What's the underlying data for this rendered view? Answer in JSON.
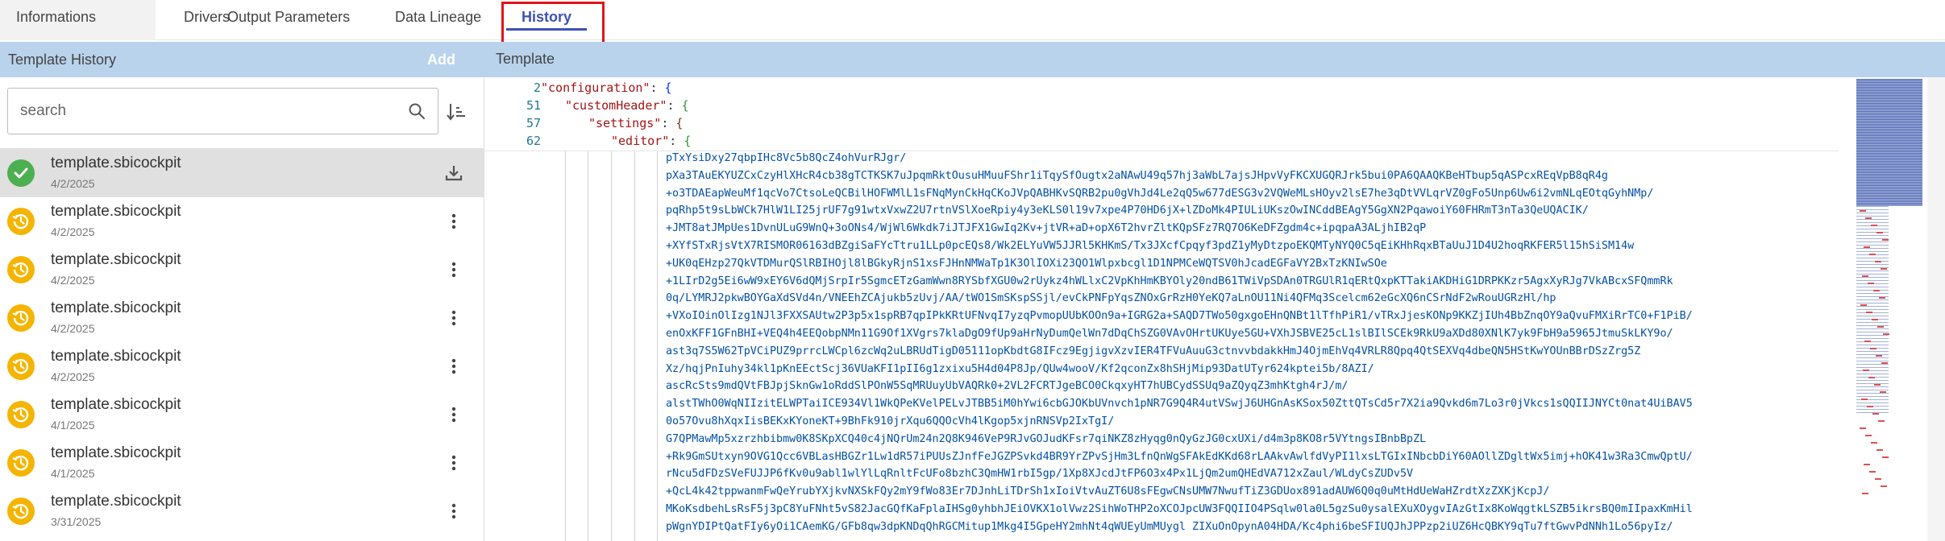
{
  "tabs": [
    {
      "label": "Informations"
    },
    {
      "label": "Drivers"
    },
    {
      "label": "Output Parameters"
    },
    {
      "label": "Data Lineage"
    },
    {
      "label": "History",
      "active": true
    }
  ],
  "header": {
    "left_title": "Template History",
    "add_label": "Add",
    "right_title": "Template"
  },
  "search": {
    "placeholder": "search"
  },
  "icons": {
    "search": "search-icon",
    "sort": "sort-ascending-icon",
    "download": "download-icon",
    "more": "more-vertical-icon",
    "ok": "check-icon",
    "history": "history-icon"
  },
  "colors": {
    "accent": "#3f51b5",
    "highlight": "#e0151b",
    "header_bg": "#b9d3ec",
    "status_ok": "#4caf50",
    "status_history": "#f5b400"
  },
  "history": [
    {
      "name": "template.sbicockpit",
      "date": "4/2/2025",
      "status": "ok",
      "action": "download"
    },
    {
      "name": "template.sbicockpit",
      "date": "4/2/2025",
      "status": "history",
      "action": "more"
    },
    {
      "name": "template.sbicockpit",
      "date": "4/2/2025",
      "status": "history",
      "action": "more"
    },
    {
      "name": "template.sbicockpit",
      "date": "4/2/2025",
      "status": "history",
      "action": "more"
    },
    {
      "name": "template.sbicockpit",
      "date": "4/2/2025",
      "status": "history",
      "action": "more"
    },
    {
      "name": "template.sbicockpit",
      "date": "4/1/2025",
      "status": "history",
      "action": "more"
    },
    {
      "name": "template.sbicockpit",
      "date": "4/1/2025",
      "status": "history",
      "action": "more"
    },
    {
      "name": "template.sbicockpit",
      "date": "3/31/2025",
      "status": "history",
      "action": "more"
    }
  ],
  "editor": {
    "sticky_lines": [
      {
        "num": "2",
        "key": "\"configuration\"",
        "brace": "{"
      },
      {
        "num": "51",
        "key": "\"customHeader\"",
        "brace": "{"
      },
      {
        "num": "57",
        "key": "\"settings\"",
        "brace": "{"
      },
      {
        "num": "62",
        "key": "\"editor\"",
        "brace": "{"
      }
    ],
    "base64_lines": [
      "pTxYsiDxy27qbpIHc8Vc5b8QcZ4ohVurRJgr/",
      "pXa3TAuEKYUZCxCzyHlXHcR4cb38gTCTKSK7uJpqmRktOusuHMuuFShr1iTqySfOugtx2aNAwU49q57hj3aWbL7ajsJHpvVyFKCXUGQRJrk5bui0PA6QAAQKBeHTbup5qASPcxREqVpB8qR4g",
      "+o3TDAEapWeuMf1qcVo7CtsoLeQCBilHOFWMlL1sFNqMynCkHqCKoJVpQABHKvSQRB2pu0gVhJd4Le2qQ5w677dESG3v2VQWeMLsHOyv2lsE7he3qDtVVLqrVZ0gFo5Unp6Uw6i2vmNLqEOtqGyhNMp/",
      "pqRhp5t9sLbWCk7HlW1LI25jrUF7g91wtxVxwZ2U7rtnVSlXoeRpiy4y3eKLS0l19v7xpe4P70HD6jX+lZDoMk4PIULiUKszOwINCddBEAgY5GgXN2PqawoiY60FHRmT3nTa3QeUQACIK/",
      "+JMT8atJMpUes1DvnULuG9WnQ+3oONs4/WjWl6Wkdk7iJTJFX1GwIq2Kv+jtVR+aD+opX6T2hvrZltKQpSFz7RQ7O6KeDFZgdm4c+ipqpaA3ALjhIB2qP",
      "+XYfSTxRjsVtX7RISMOR06163dBZgiSaFYcTtru1LLp0pcEQs8/Wk2ELYuVW5JJRl5KHKmS/Tx3JXcfCpqyf3pdZ1yMyDtzpoEKQMTyNYQ0C5qEiKHhRqxBTaUuJ1D4U2hoqRKFER5l15hSiSM14w",
      "+UK0qEHzp27QkVTDMurQSlRBIHOjl8lBGkyRjnS1xsFJHnNMWaTp1K3OlIOXi23QO1Wlpxbcgl1D1NPMCeWQTSV0hJcadEGFaVY2BxTzKNIwSOe",
      "+1LIrD2g5Ei6wW9xEY6V6dQMjSrpIr5SgmcETzGamWwn8RYSbfXGU0w2rUykz4hWLlxC2VpKhHmKBYOly20ndB61TWiVpSDAn0TRGUlR1qERtQxpKTTakiAKDHiG1DRPKKzr5AgxXyRJg7VkABcxSFQmmRk",
      "0q/LYMRJ2pkwBOYGaXdSVd4n/VNEEhZCAjukb5zUvj/AA/tWO1SmSKspSSjl/evCkPNFpYqsZNOxGrRzH0YeKQ7aLnOU11Ni4QFMq3Scelcm62eGcXQ6nCSrNdF2wRouUGRzHl/hp",
      "+VXoIOinOlIzg1NJl3FXXSAUtw2P3p5x1spRB7qpIPkKRtUFNvqI7yzqPvmopUUbKOOn9a+IGRG2a+SAQD7TWo50gxgoEHnQNBt1lTfhPiR1/vTRxJjesKONp9KKZjIUh4BbZnqOY9aQvuFMXiRrTC0+F1PiB/",
      "enOxKFF1GFnBHI+VEQ4h4EEQobpNMn11G9Of1XVgrs7klaDgO9fUp9aHrNyDumQelWn7dDqChSZG0VAvOHrtUKUye5GU+VXhJSBVE25cL1slBIlSCEk9RkU9aXDd80XNlK7yk9FbH9a5965JtmuSkLKY9o/",
      "ast3q7S5W62TpVCiPUZ9prrcLWCpl6zcWq2uLBRUdTigD05111opKbdtG8IFcz9EgjigvXzvIER4TFVuAuuG3ctnvvbdakkHmJ4OjmEhVq4VRLR8Qpq4QtSEXVq4dbeQN5HStKwYOUnBBrDSzZrg5Z",
      "Xz/hqjPnIuhy34kl1pKnEEctScj36VUaKFI1pII6g1zxixu5H4d04P8Jp/QUw4wooV/Kf2qconZx8hSHjMip93DatUTyr624kptei5b/8AZI/",
      "ascRcSts9mdQVtFBJpjSknGw1oRddSlPOnW5SqMRUuyUbVAQRk0+2VL2FCRTJgeBCO0CkqxyHT7hUBCydSSUq9aZQyqZ3mhKtgh4rJ/m/",
      "alstTWhO0WqNIIzitELWPTaiICE934Vl1WkQPeKVelPELvJTBB5iM0hYwi6cbGJOKbUVnvch1pNR7G9Q4R4utVSwjJ6UHGnAsKSox50ZttQTsCd5r7X2ia9Qvkd6m7Lo3r0jVkcs1sQQIIJNYCt0nat4UiBAV5",
      "0o57Ovu8hXqxIisBEKxKYoneKT+9BhFk910jrXqu6QQOcVh4lKgop5xjnRNSVp2IxTgI/",
      "G7QPMawMp5xzrzhbibmw0K8SKpXCQ40c4jNQrUm24n2Q8K946VeP9RJvGOJudKFsr7qiNKZ8zHyqg0nQyGzJG0cxUXi/d4m3p8KO8r5VYtngsIBnbBpZL",
      "+Rk9GmSUtxyn9OVG1Qcc6VBLasHBGZr1Lw1dR57iPUUsZJnfFeJGZPSvkd4BR9YrZPvSjHm3LfnQnWgSFAkEdKKd68rLAAkvAwlfdVyPI1lxsLTGIxINbcbDiY60AOllZDgltWx5imj+hOK41w3Ra3CmwQptU/",
      "rNcu5dFDzSVeFUJJP6fKv0u9abl1wlYlLqRnltFcUFo8bzhC3QmHW1rbI5gp/1Xp8XJcdJtFP6O3x4Px1LjQm2umQHEdVA712xZaul/WLdyCsZUDv5V",
      "+QcL4k42tppwanmFwQeYrubYXjkvNXSkFQy2mY9fWo83Er7DJnhLiTDrSh1xIoiVtvAuZT6U8sFEgwCNsUMW7NwufTiZ3GDUox891adAUW6Q0q0uMtHdUeWaHZrdtXzZXKjKcpJ/",
      "MKoKsdbehLsRsF5j3pC8YuFNht5vS82JacGQfKaFplaIHSg0yhbhJEiOVKX1olVwz2SihWoTHP2oXCOJpcUW3FQQIIO4PSqlw0la0L5gzSu0ysalEXuXOygvIAzGtIx8KoWqgtkLSZB5ikrsBQ0mIIpaxKmHil",
      "pWgnYDIPtQatFIy6yOi1CAemKG/GFb8qw3dpKNDqQhRGCMitup1Mkg4I5GpeHY2mhNt4qWUEyUmMUygl ZIXuOnOpynA04HDA/Kc4phi6beSFIUQJhJPPzp2iUZ6HcQBKY9qTu7ftGwvPdNNh1Lo56pyIz/"
    ]
  }
}
